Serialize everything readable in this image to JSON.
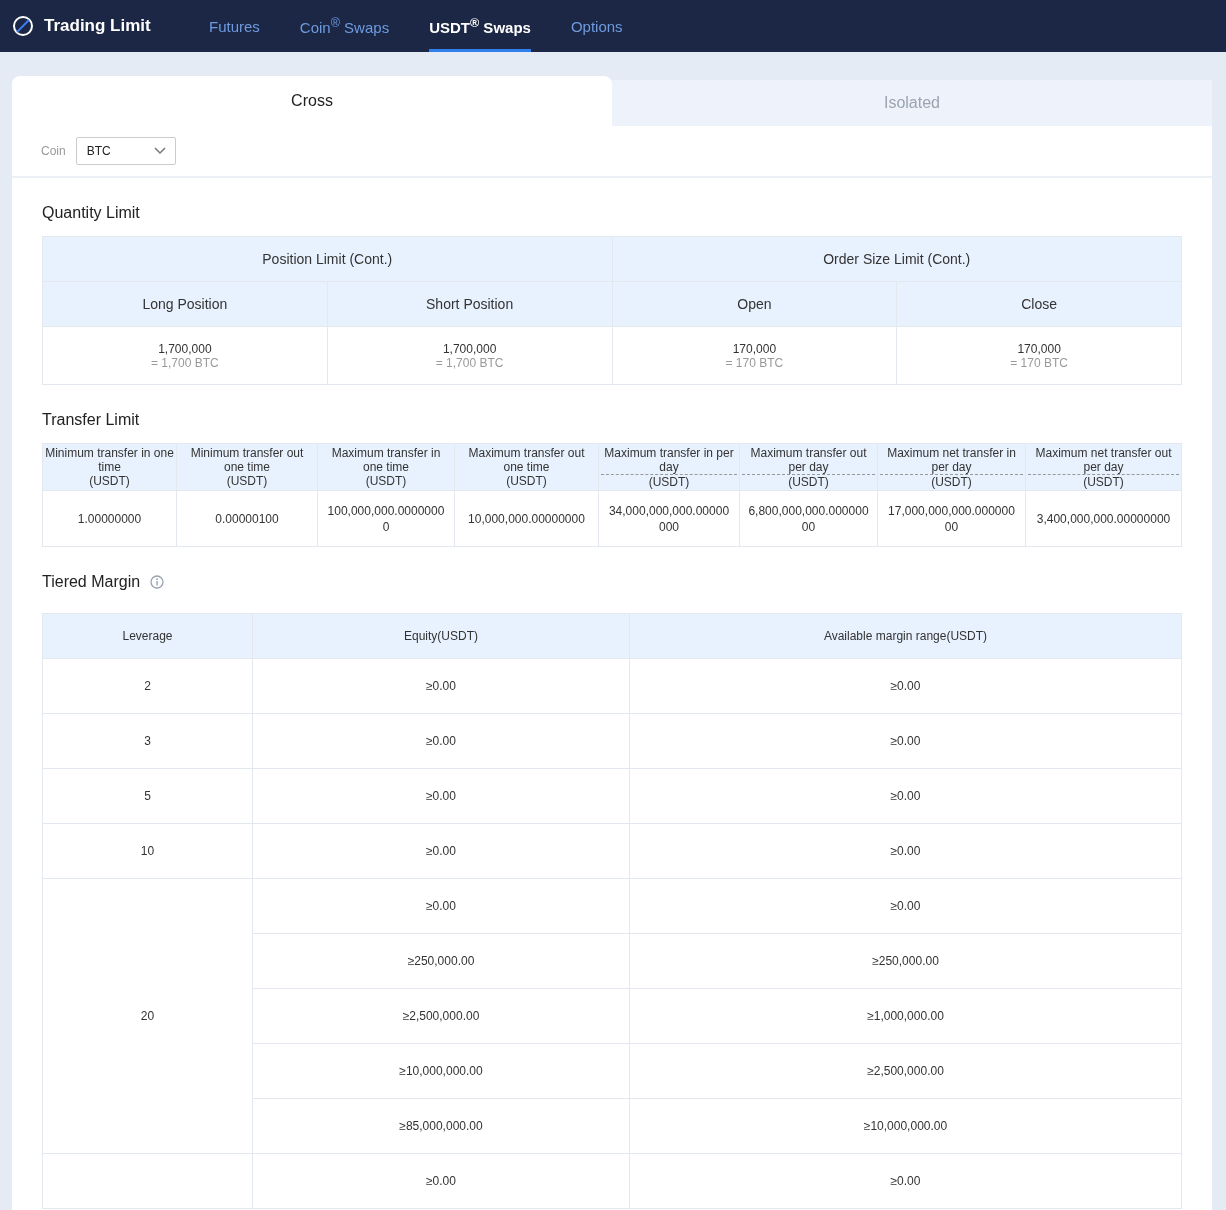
{
  "header": {
    "title": "Trading Limit",
    "nav": [
      {
        "label": "Futures",
        "selected": false
      },
      {
        "label": "Coin$^{®}$ Swaps",
        "selected": false
      },
      {
        "label": "USDT$^{®}$ Swaps",
        "selected": true
      },
      {
        "label": "Options",
        "selected": false
      }
    ]
  },
  "mode_tabs": [
    {
      "label": "Cross",
      "selected": true
    },
    {
      "label": "Isolated",
      "selected": false
    }
  ],
  "coin_filter": {
    "label": "Coin",
    "value": "BTC"
  },
  "quantity_limit": {
    "title": "Quantity Limit",
    "groups": [
      "Position Limit (Cont.)",
      "Order Size Limit (Cont.)"
    ],
    "columns": [
      "Long Position",
      "Short Position",
      "Open",
      "Close"
    ],
    "cells": [
      {
        "value": "1,700,000",
        "sub": "= 1,700 BTC"
      },
      {
        "value": "1,700,000",
        "sub": "= 1,700 BTC"
      },
      {
        "value": "170,000",
        "sub": "= 170 BTC"
      },
      {
        "value": "170,000",
        "sub": "= 170 BTC"
      }
    ]
  },
  "transfer_limit": {
    "title": "Transfer Limit",
    "columns": [
      {
        "label": "Minimum transfer in one time",
        "unit": "(USDT)",
        "kind": "plain"
      },
      {
        "label": "Minimum transfer out one time",
        "unit": "(USDT)",
        "kind": "plain"
      },
      {
        "label": "Maximum transfer in one time",
        "unit": "(USDT)",
        "kind": "plain"
      },
      {
        "label": "Maximum transfer out one time",
        "unit": "(USDT)",
        "kind": "plain"
      },
      {
        "label": "Maximum transfer in per day",
        "unit": "(USDT)",
        "kind": "daily"
      },
      {
        "label": "Maximum transfer out per day",
        "unit": "(USDT)",
        "kind": "daily"
      },
      {
        "label": "Maximum net transfer in per day",
        "unit": "(USDT)",
        "kind": "daily"
      },
      {
        "label": "Maximum net transfer out per day",
        "unit": "(USDT)",
        "kind": "daily"
      }
    ],
    "values": [
      "1.00000000",
      "0.00000100",
      "100,000,000.00000000",
      "10,000,000.00000000",
      "34,000,000,000.00000000",
      "6,800,000,000.00000000",
      "17,000,000,000.00000000",
      "3,400,000,000.00000000"
    ]
  },
  "tiered_margin": {
    "title": "Tiered Margin",
    "columns": [
      "Leverage",
      "Equity(USDT)",
      "Available margin range(USDT)"
    ],
    "tiers": [
      {
        "leverage": "2",
        "rows": [
          [
            "≥0.00",
            "≥0.00"
          ]
        ]
      },
      {
        "leverage": "3",
        "rows": [
          [
            "≥0.00",
            "≥0.00"
          ]
        ]
      },
      {
        "leverage": "5",
        "rows": [
          [
            "≥0.00",
            "≥0.00"
          ]
        ]
      },
      {
        "leverage": "10",
        "rows": [
          [
            "≥0.00",
            "≥0.00"
          ]
        ]
      },
      {
        "leverage": "20",
        "rows": [
          [
            "≥0.00",
            "≥0.00"
          ],
          [
            "≥250,000.00",
            "≥250,000.00"
          ],
          [
            "≥2,500,000.00",
            "≥1,000,000.00"
          ],
          [
            "≥10,000,000.00",
            "≥2,500,000.00"
          ],
          [
            "≥85,000,000.00",
            "≥10,000,000.00"
          ]
        ]
      },
      {
        "rows": [
          [
            "≥0.00",
            "≥0.00"
          ]
        ]
      }
    ]
  }
}
